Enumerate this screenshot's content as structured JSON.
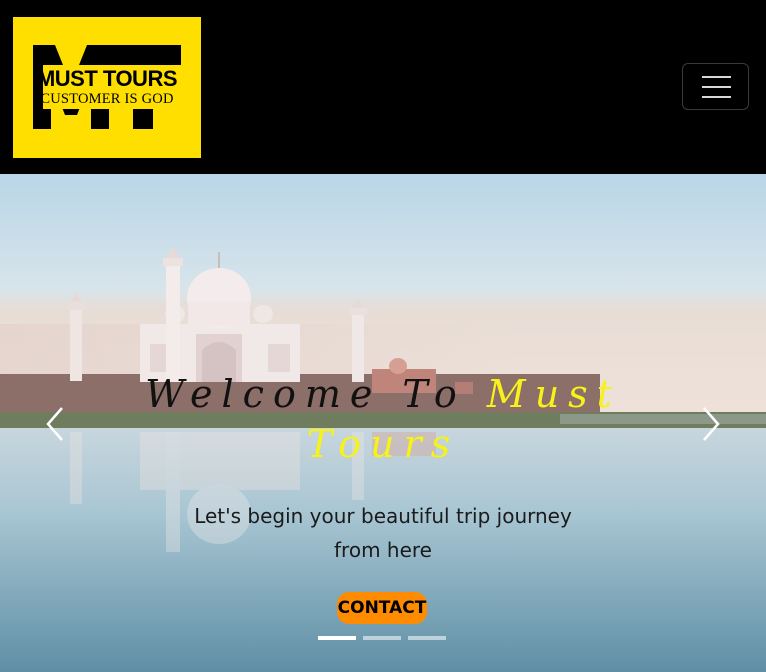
{
  "brand": {
    "monogram": "MT",
    "name": "MUST TOURS",
    "tagline": "CUSTOMER IS GOD",
    "logo_color": "#ffdf00"
  },
  "navbar": {
    "toggle_icon": "hamburger-menu-icon"
  },
  "carousel": {
    "title_prefix": "Welcome To ",
    "title_accent": "Must Tours",
    "subtitle": "Let's begin your beautiful trip journey from here",
    "contact_label": "CONTACT",
    "accent_color": "#f6f21a",
    "button_color": "#ff8c00",
    "prev_icon": "chevron-left-icon",
    "next_icon": "chevron-right-icon",
    "slide_count": 3,
    "active_slide": 1
  }
}
